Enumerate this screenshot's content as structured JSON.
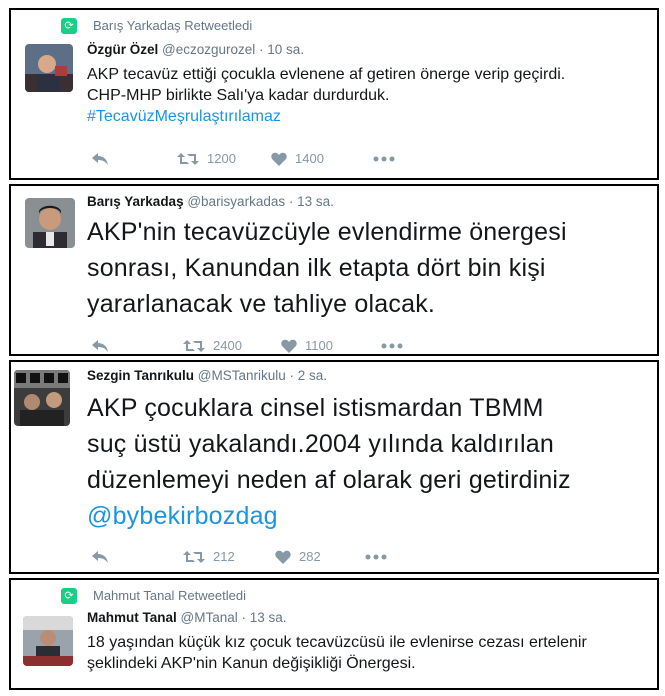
{
  "tweets": [
    {
      "retweet_by": "Barış Yarkadaş Retweetledi",
      "name": "Özgür Özel",
      "handle": "@eczozgurozel",
      "time": "· 10 sa.",
      "lines": [
        "AKP tecavüz ettiği çocukla evlenene af getiren önerge verip geçirdi.",
        "CHP-MHP birlikte Salı'ya kadar durdurduk."
      ],
      "hashtag": "#TecavüzMeşrulaştırılamaz",
      "retweets": "1200",
      "likes": "1400"
    },
    {
      "name": "Barış Yarkadaş",
      "handle": "@barisyarkadas",
      "time": "· 13 sa.",
      "lines": [
        "AKP'nin tecavüzcüyle evlendirme önergesi",
        "sonrası, Kanundan ilk etapta dört bin kişi",
        "yararlanacak ve tahliye olacak."
      ],
      "retweets": "2400",
      "likes": "1100"
    },
    {
      "name": "Sezgin Tanrıkulu",
      "handle": "@MSTanrikulu",
      "time": "· 2 sa.",
      "lines": [
        "AKP çocuklara cinsel istismardan TBMM",
        "suç üstü yakalandı.2004 yılında kaldırılan",
        "düzenlemeyi neden af olarak geri getirdiniz"
      ],
      "mention": "@bybekirbozdag",
      "retweets": "212",
      "likes": "282"
    },
    {
      "retweet_by": "Mahmut Tanal Retweetledi",
      "name": "Mahmut Tanal",
      "handle": "@MTanal",
      "time": "· 13 sa.",
      "lines": [
        "18 yaşından küçük kız çocuk tecavüzcüsü ile evlenirse cezası ertelenir",
        "şeklindeki AKP'nin Kanun değişikliği Önergesi."
      ]
    }
  ],
  "icons": {
    "retweet_badge": "retweet-icon",
    "reply": "reply-icon",
    "retweet": "retweet-icon",
    "like": "heart-icon",
    "more": "more-icon"
  },
  "colors": {
    "link": "#1b95e0",
    "retweet_badge": "#19cf86",
    "muted": "#657786",
    "action": "#8899a6"
  }
}
